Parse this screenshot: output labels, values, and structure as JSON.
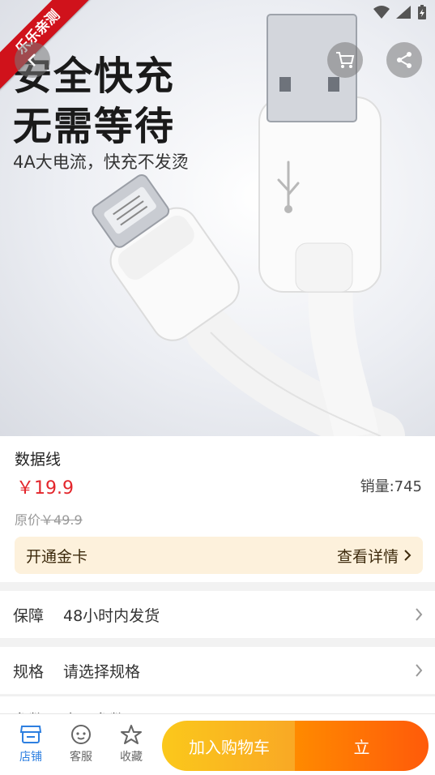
{
  "hero": {
    "headline_line1": "安全快充",
    "headline_line2": "无需等待",
    "subline": "4A大电流，快充不发烫",
    "ribbon": "乐乐亲测"
  },
  "product": {
    "name": "数据线",
    "price": "￥19.9",
    "sales": "销量:745",
    "original_label": "原价",
    "original_price": "￥49.9"
  },
  "gold_card": {
    "title": "开通金卡",
    "link": "查看详情"
  },
  "rows": [
    {
      "key": "保障",
      "value": "48小时内发货"
    },
    {
      "key": "规格",
      "value": "请选择规格"
    },
    {
      "key": "参数",
      "value": "产品参数"
    }
  ],
  "bottom": {
    "tabs": [
      {
        "label": "店铺",
        "icon": "store-icon",
        "active": true
      },
      {
        "label": "客服",
        "icon": "service-icon"
      },
      {
        "label": "收藏",
        "icon": "star-icon"
      }
    ],
    "add_to_cart": "加入购物车",
    "buy_now": "立"
  },
  "colors": {
    "price": "#e3252b",
    "active_tab": "#2d7fe0",
    "cart_button": "#f9b81f",
    "buy_button": "#ff6a05",
    "ribbon": "#d0121b"
  }
}
